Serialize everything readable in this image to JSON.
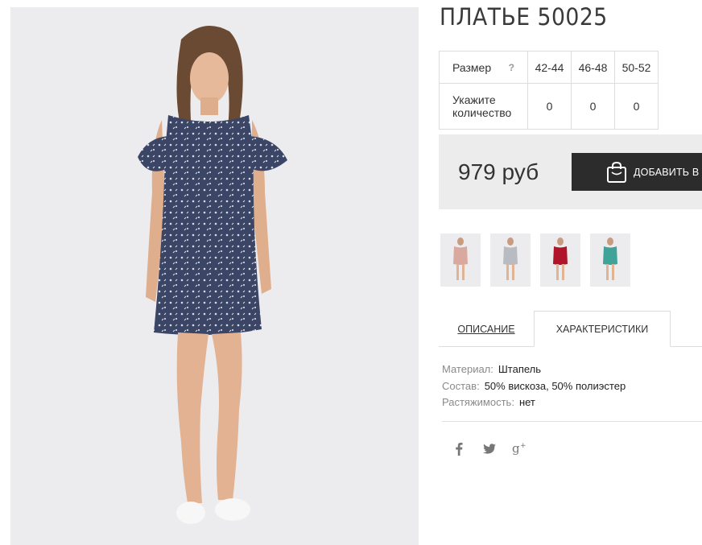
{
  "product": {
    "title": "ПЛАТЬЕ 50025",
    "price": "979 руб",
    "add_to_cart_label": "ДОБАВИТЬ В",
    "main_image_icon": "dress-photo"
  },
  "size_table": {
    "size_label": "Размер",
    "help_symbol": "?",
    "qty_label": "Укажите количество",
    "sizes": [
      "42-44",
      "46-48",
      "50-52"
    ],
    "quantities": [
      "0",
      "0",
      "0"
    ]
  },
  "thumbnails": [
    {
      "name": "thumb-beige",
      "color": "#d9a9a0"
    },
    {
      "name": "thumb-gray",
      "color": "#b8bcc2"
    },
    {
      "name": "thumb-red",
      "color": "#b0142a"
    },
    {
      "name": "thumb-teal",
      "color": "#3fa39a"
    }
  ],
  "tabs": {
    "description": "ОПИСАНИЕ",
    "characteristics": "ХАРАКТЕРИСТИКИ"
  },
  "characteristics": [
    {
      "key": "Материал:",
      "value": "Штапель"
    },
    {
      "key": "Состав:",
      "value": "50% вискоза, 50% полиэстер"
    },
    {
      "key": "Растяжимость:",
      "value": "нет"
    }
  ],
  "social": [
    "facebook-icon",
    "twitter-icon",
    "google-plus-icon"
  ],
  "colors": {
    "button_bg": "#2c2c2c",
    "price_bar_bg": "#ececec",
    "dress_navy": "#3b4566"
  }
}
